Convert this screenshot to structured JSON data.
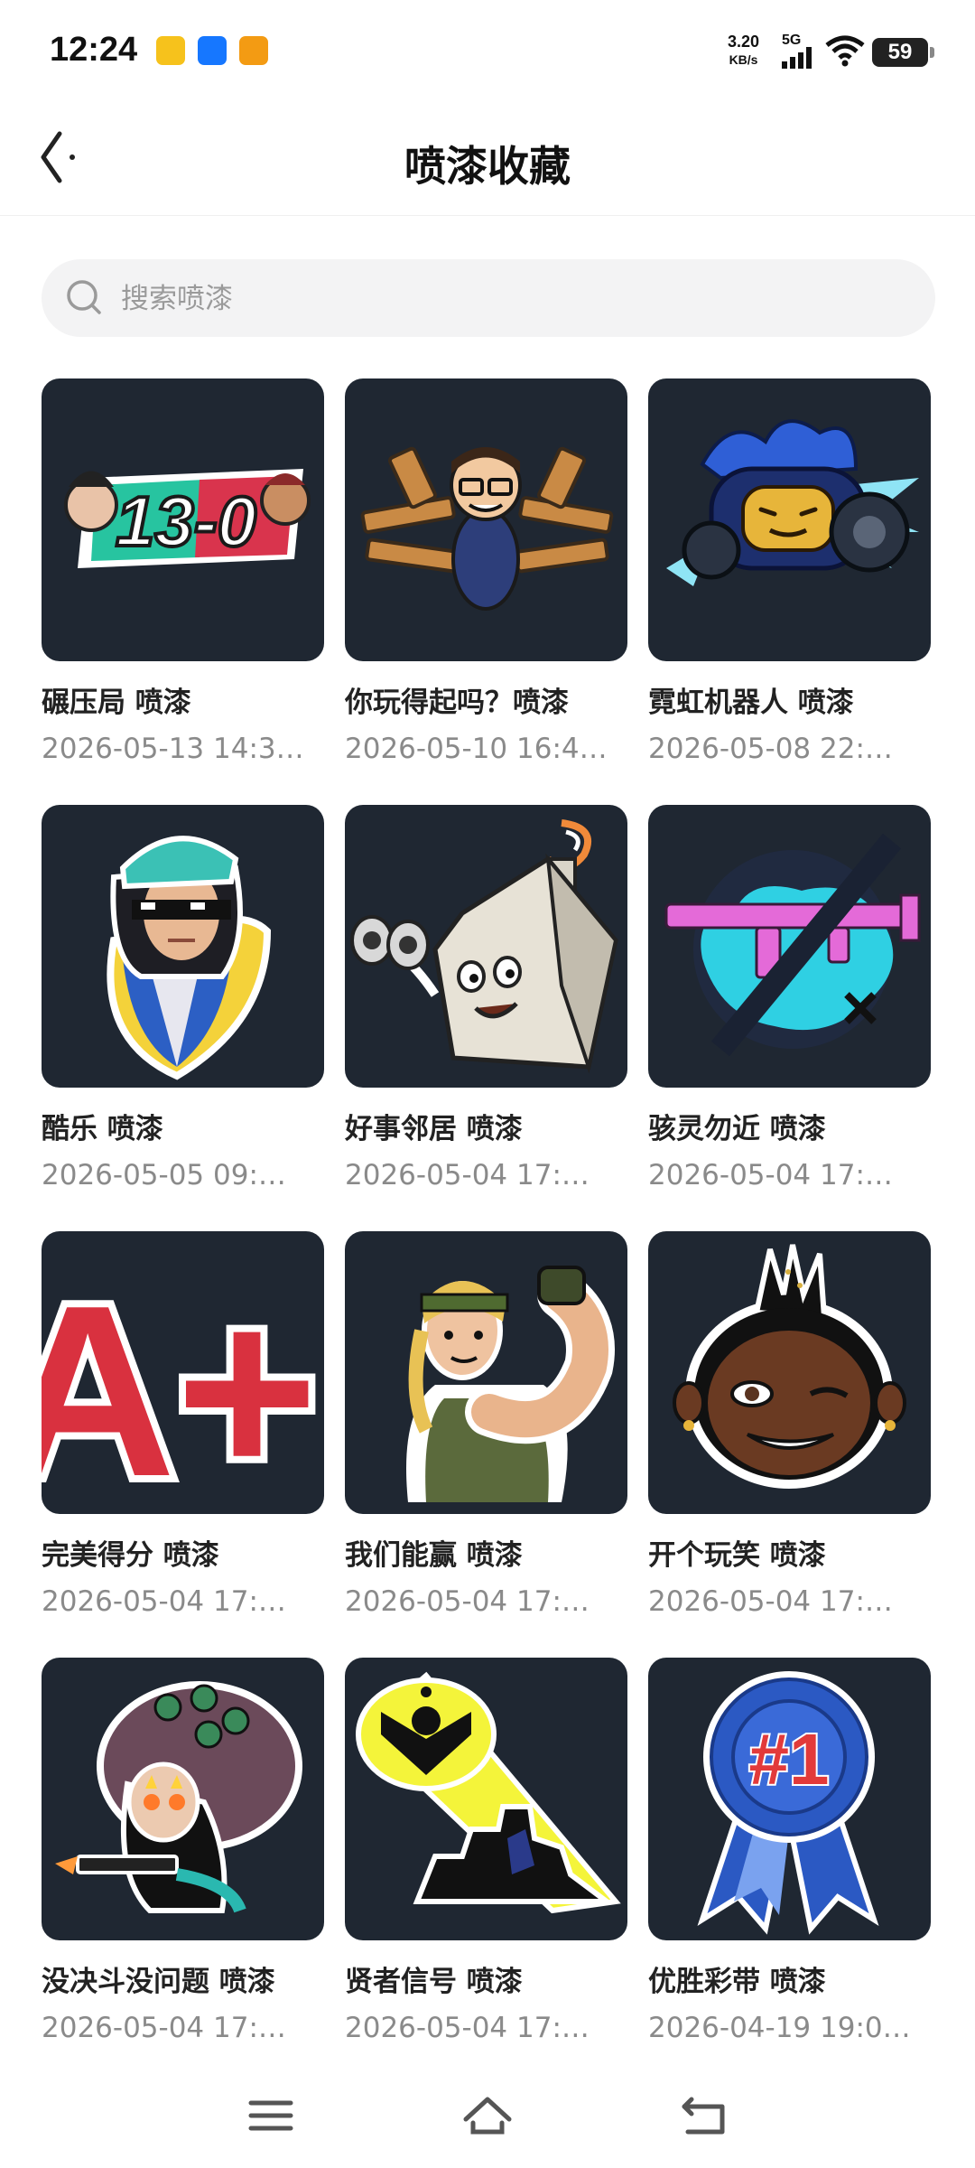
{
  "status": {
    "time": "12:24",
    "speed_value": "3.20",
    "speed_unit": "KB/s",
    "network": "5G",
    "battery": "59"
  },
  "header": {
    "title": "喷漆收藏"
  },
  "search": {
    "placeholder": "搜索喷漆"
  },
  "items": [
    {
      "name": "碾压局 喷漆",
      "date": "2026-05-13 14:3…",
      "icon": "13-0-spray-icon"
    },
    {
      "name": "你玩得起吗？喷漆",
      "date": "2026-05-10 16:4…",
      "icon": "guns-man-spray-icon"
    },
    {
      "name": "霓虹机器人 喷漆",
      "date": "2026-05-08 22:…",
      "icon": "neon-robot-spray-icon"
    },
    {
      "name": "酷乐 喷漆",
      "date": "2026-05-05 09:…",
      "icon": "cool-girl-spray-icon"
    },
    {
      "name": "好事邻居 喷漆",
      "date": "2026-05-04 17:…",
      "icon": "house-binoculars-spray-icon"
    },
    {
      "name": "骇灵勿近 喷漆",
      "date": "2026-05-04 17:…",
      "icon": "crossed-gun-spray-icon"
    },
    {
      "name": "完美得分 喷漆",
      "date": "2026-05-04 17:…",
      "icon": "a-plus-spray-icon"
    },
    {
      "name": "我们能赢 喷漆",
      "date": "2026-05-04 17:…",
      "icon": "flexing-woman-spray-icon"
    },
    {
      "name": "开个玩笑 喷漆",
      "date": "2026-05-04 17:…",
      "icon": "winking-face-spray-icon"
    },
    {
      "name": "没决斗没问题 喷漆",
      "date": "2026-05-04 17:…",
      "icon": "fire-eyes-agent-spray-icon"
    },
    {
      "name": "贤者信号 喷漆",
      "date": "2026-05-04 17:…",
      "icon": "sage-signal-spray-icon"
    },
    {
      "name": "优胜彩带 喷漆",
      "date": "2026-04-19 19:0…",
      "icon": "number-one-ribbon-spray-icon"
    }
  ],
  "thumb_text": {
    "score": "13-0",
    "grade": "A+",
    "rank": "#1"
  },
  "colors": {
    "thumb_bg": "#1f2732",
    "date_text": "#8a8a8a"
  }
}
